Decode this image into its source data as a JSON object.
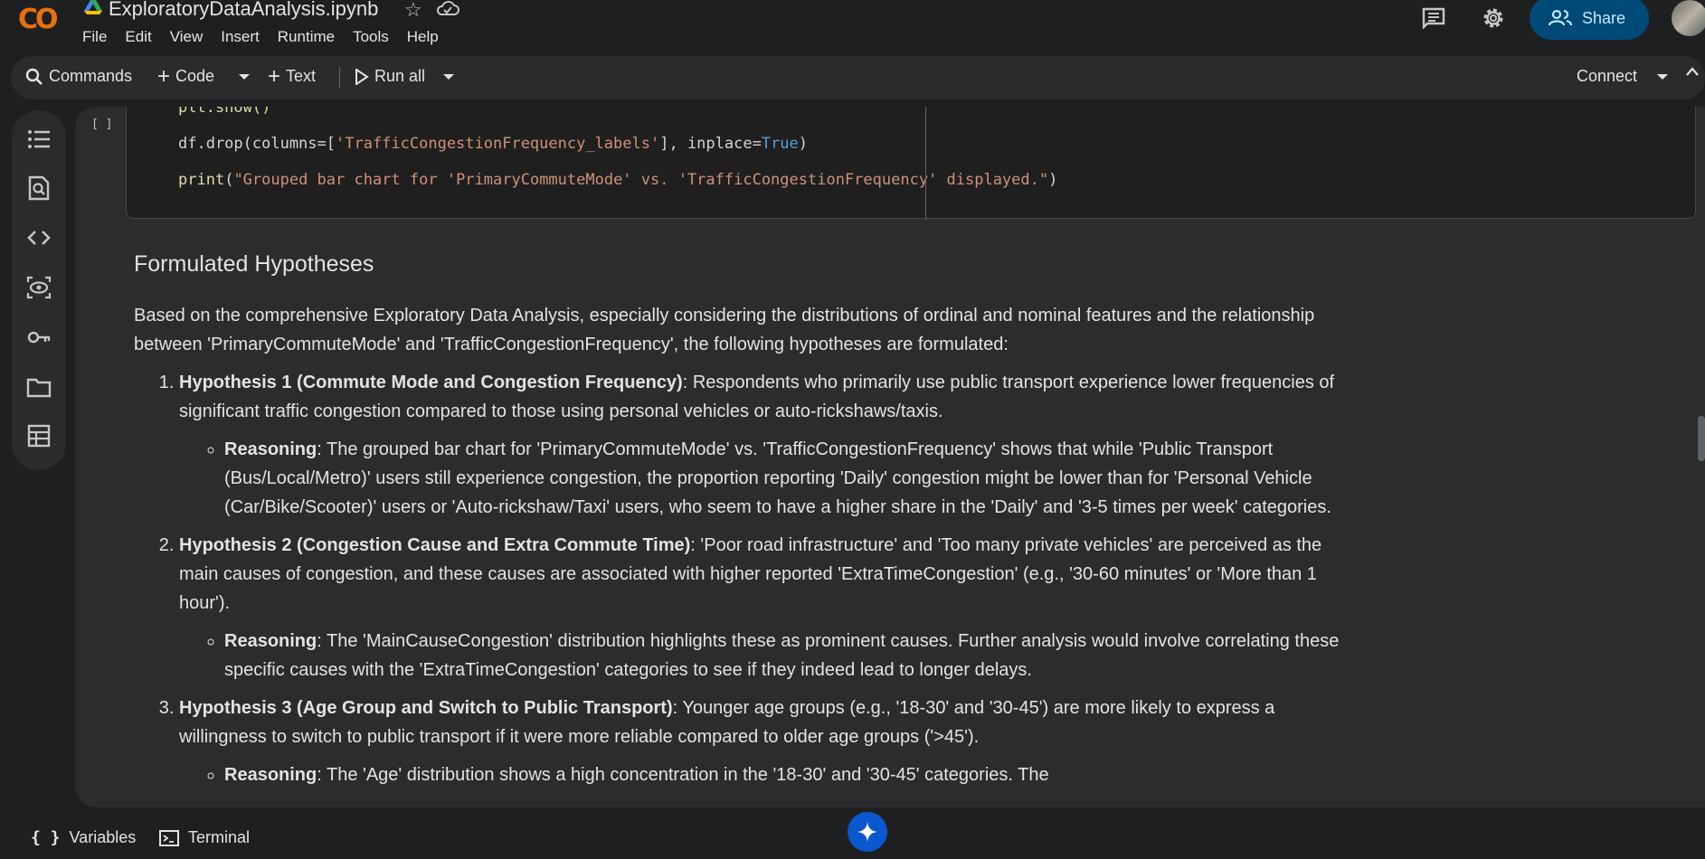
{
  "header": {
    "logo_main": "C",
    "logo_accent": "O",
    "notebook_title": "ExploratoryDataAnalysis.ipynb",
    "menu": [
      "File",
      "Edit",
      "View",
      "Insert",
      "Runtime",
      "Tools",
      "Help"
    ],
    "share_label": "Share"
  },
  "toolbar": {
    "commands_label": "Commands",
    "code_label": "Code",
    "text_label": "Text",
    "run_all_label": "Run all",
    "connect_label": "Connect"
  },
  "code_cell": {
    "exec_count": "[ ]",
    "line_partial": "plt.show()",
    "line1_pre": "df.drop(columns=[",
    "line1_str": "'TrafficCongestionFrequency_labels'",
    "line1_mid": "], inplace=",
    "line1_kw": "True",
    "line1_post": ")",
    "line2_fn": "print",
    "line2_pre": "(",
    "line2_str": "\"Grouped bar chart for 'PrimaryCommuteMode' vs. 'TrafficCongestionFrequency' displayed.\"",
    "line2_post": ")"
  },
  "markdown": {
    "heading": "Formulated Hypotheses",
    "intro": "Based on the comprehensive Exploratory Data Analysis, especially considering the distributions of ordinal and nominal features and the relationship between 'PrimaryCommuteMode' and 'TrafficCongestionFrequency', the following hypotheses are formulated:",
    "items": [
      {
        "title": "Hypothesis 1 (Commute Mode and Congestion Frequency)",
        "text": ": Respondents who primarily use public transport experience lower frequencies of significant traffic congestion compared to those using personal vehicles or auto-rickshaws/taxis.",
        "reason_label": "Reasoning",
        "reason_text": ": The grouped bar chart for 'PrimaryCommuteMode' vs. 'TrafficCongestionFrequency' shows that while 'Public Transport (Bus/Local/Metro)' users still experience congestion, the proportion reporting 'Daily' congestion might be lower than for 'Personal Vehicle (Car/Bike/Scooter)' users or 'Auto-rickshaw/Taxi' users, who seem to have a higher share in the 'Daily' and '3-5 times per week' categories."
      },
      {
        "title": "Hypothesis 2 (Congestion Cause and Extra Commute Time)",
        "text": ": 'Poor road infrastructure' and 'Too many private vehicles' are perceived as the main causes of congestion, and these causes are associated with higher reported 'ExtraTimeCongestion' (e.g., '30-60 minutes' or 'More than 1 hour').",
        "reason_label": "Reasoning",
        "reason_text": ": The 'MainCauseCongestion' distribution highlights these as prominent causes. Further analysis would involve correlating these specific causes with the 'ExtraTimeCongestion' categories to see if they indeed lead to longer delays."
      },
      {
        "title": "Hypothesis 3 (Age Group and Switch to Public Transport)",
        "text": ": Younger age groups (e.g., '18-30' and '30-45') are more likely to express a willingness to switch to public transport if it were more reliable compared to older age groups ('>45').",
        "reason_label": "Reasoning",
        "reason_text": ": The 'Age' distribution shows a high concentration in the '18-30' and '30-45' categories. The"
      }
    ]
  },
  "bottom": {
    "variables_label": "Variables",
    "terminal_label": "Terminal"
  },
  "colors": {
    "background": "#1e1f20",
    "share_bg": "#004a77",
    "accent_blue": "#0b57d0",
    "logo_orange": "#f9ab00"
  }
}
